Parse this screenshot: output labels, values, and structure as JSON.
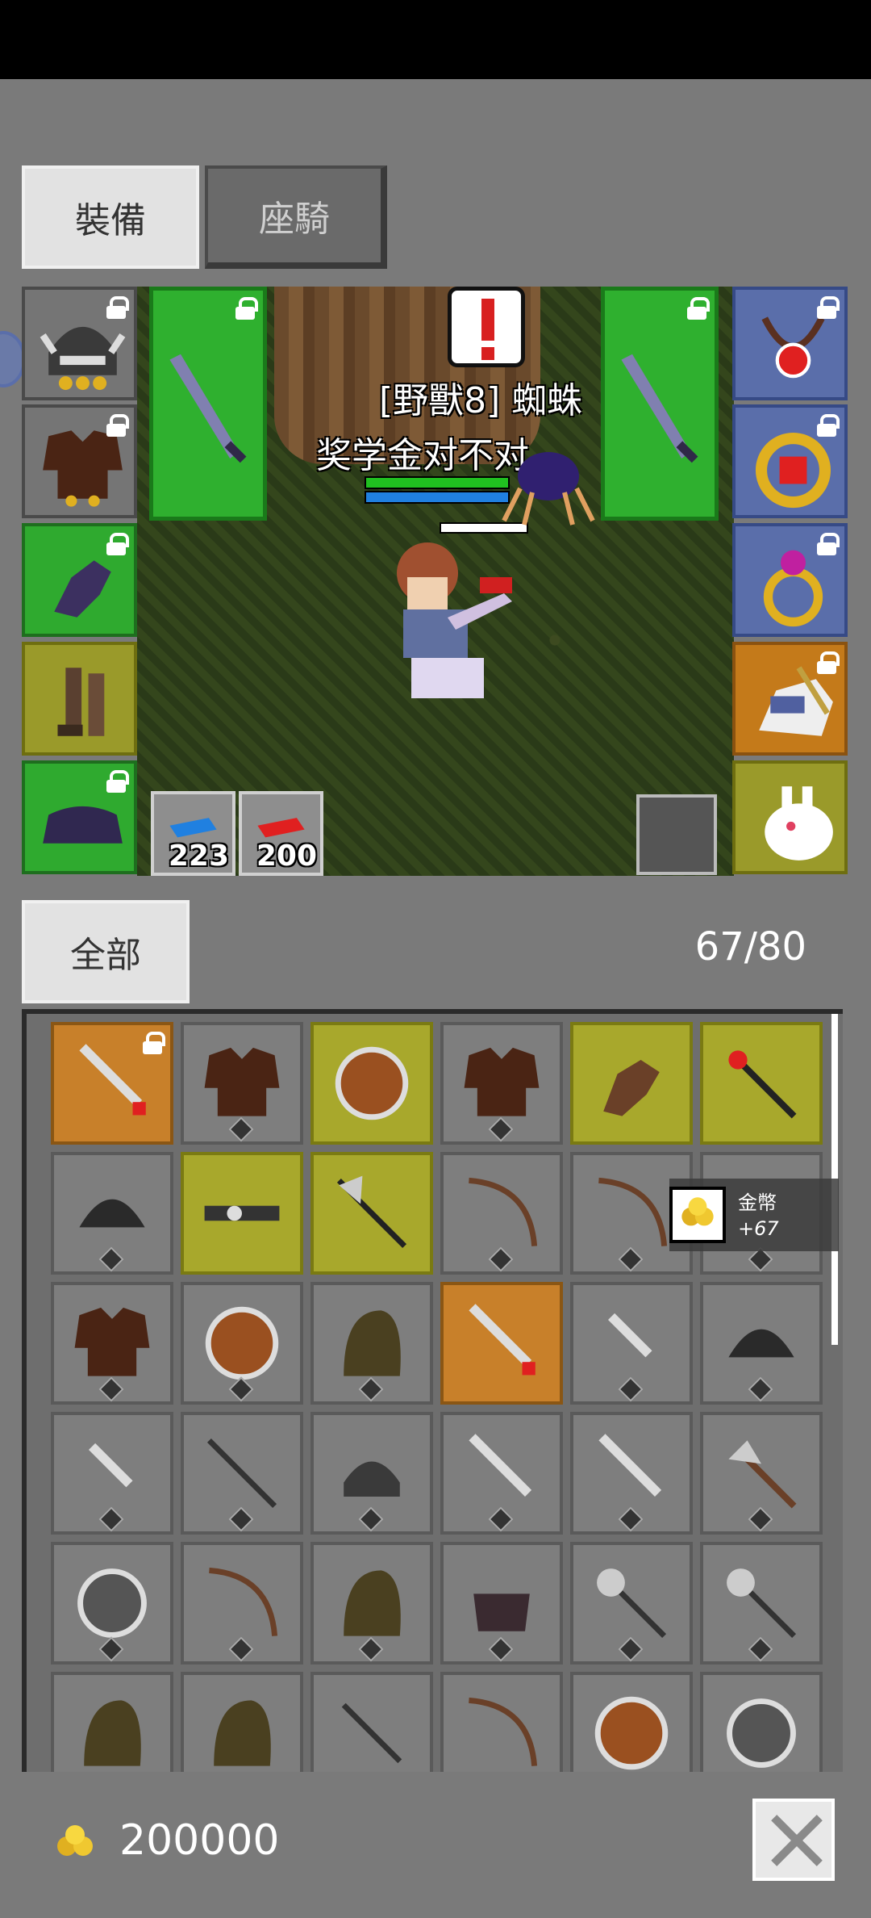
{
  "tabs": {
    "equip": "裝備",
    "mount": "座騎"
  },
  "scene": {
    "monster_label": "[野獸8] 蜘蛛",
    "player_name": "奖学金对不对",
    "potions": {
      "blue": "223",
      "red": "200"
    }
  },
  "filter": {
    "label": "全部",
    "count": "67/80"
  },
  "gold_popup": {
    "name": "金幣",
    "amount": "+67"
  },
  "gold_total": "200000",
  "inventory_rows": 6,
  "colors": {
    "green": "#2faa2f",
    "olive": "#a8a82c",
    "blue_slot": "#5a6eaa",
    "orange": "#c8802a"
  }
}
